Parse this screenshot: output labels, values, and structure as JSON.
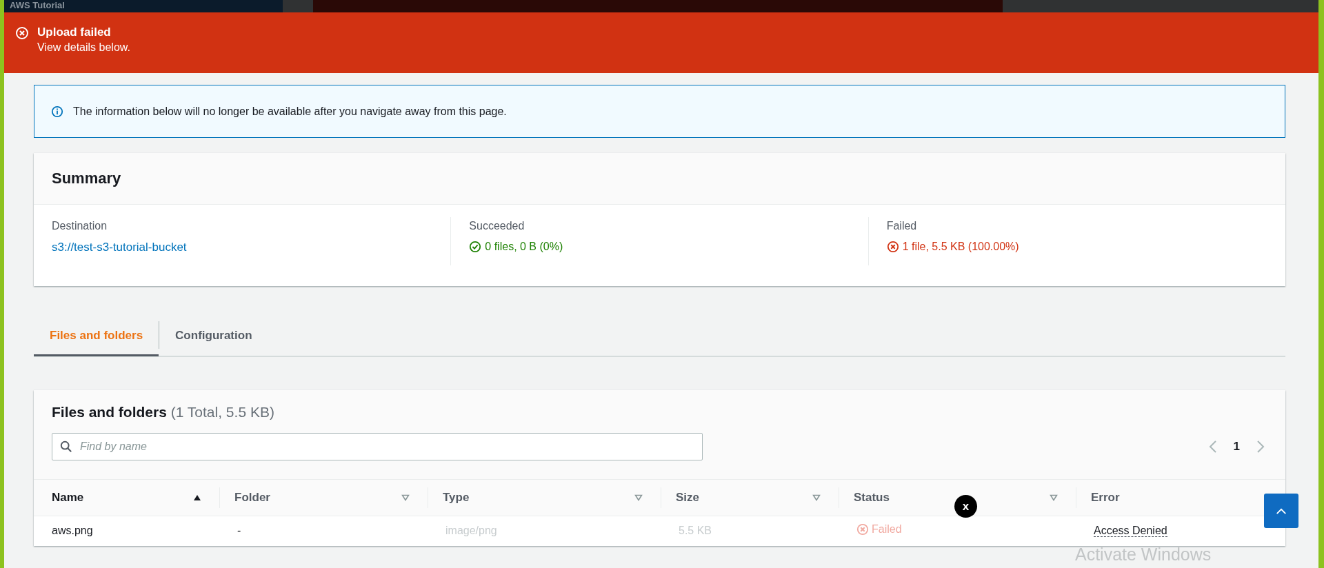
{
  "top_strip": {
    "title": "AWS Tutorial"
  },
  "flash": {
    "kind": "error",
    "title": "Upload failed",
    "message": "View details below."
  },
  "info": {
    "message": "The information below will no longer be available after you navigate away from this page."
  },
  "summary": {
    "title": "Summary",
    "items": [
      {
        "label": "Destination",
        "value": "s3://test-s3-tutorial-bucket",
        "kind": "link"
      },
      {
        "label": "Succeeded",
        "value": "0 files, 0 B (0%)",
        "kind": "success"
      },
      {
        "label": "Failed",
        "value": "1 file, 5.5 KB (100.00%)",
        "kind": "error"
      }
    ]
  },
  "tabs": [
    {
      "label": "Files and folders",
      "selected": true
    },
    {
      "label": "Configuration",
      "selected": false
    }
  ],
  "files": {
    "title": "Files and folders",
    "count": "(1 Total, 5.5 KB)",
    "search": {
      "placeholder": "Find by name"
    },
    "pagination": {
      "page": "1"
    },
    "columns": [
      {
        "label": "Name",
        "kind": "sorted"
      },
      {
        "label": "Folder",
        "kind": "sortable"
      },
      {
        "label": "Type",
        "kind": "sortable"
      },
      {
        "label": "Size",
        "kind": "sortable"
      },
      {
        "label": "Status",
        "kind": "sortable"
      },
      {
        "label": "Error",
        "kind": "plain"
      }
    ],
    "rows": [
      {
        "cells": [
          {
            "text": "aws.png",
            "kind": "text"
          },
          {
            "text": "-",
            "kind": "text"
          },
          {
            "text": "image/png",
            "kind": "muted"
          },
          {
            "text": "5.5 KB",
            "kind": "muted"
          },
          {
            "text": "Failed",
            "kind": "status-error"
          },
          {
            "text": "Access Denied",
            "kind": "error-link"
          }
        ]
      }
    ]
  },
  "overlay_close": {
    "label": "x"
  },
  "os_notice": {
    "text": "Activate Windows"
  }
}
